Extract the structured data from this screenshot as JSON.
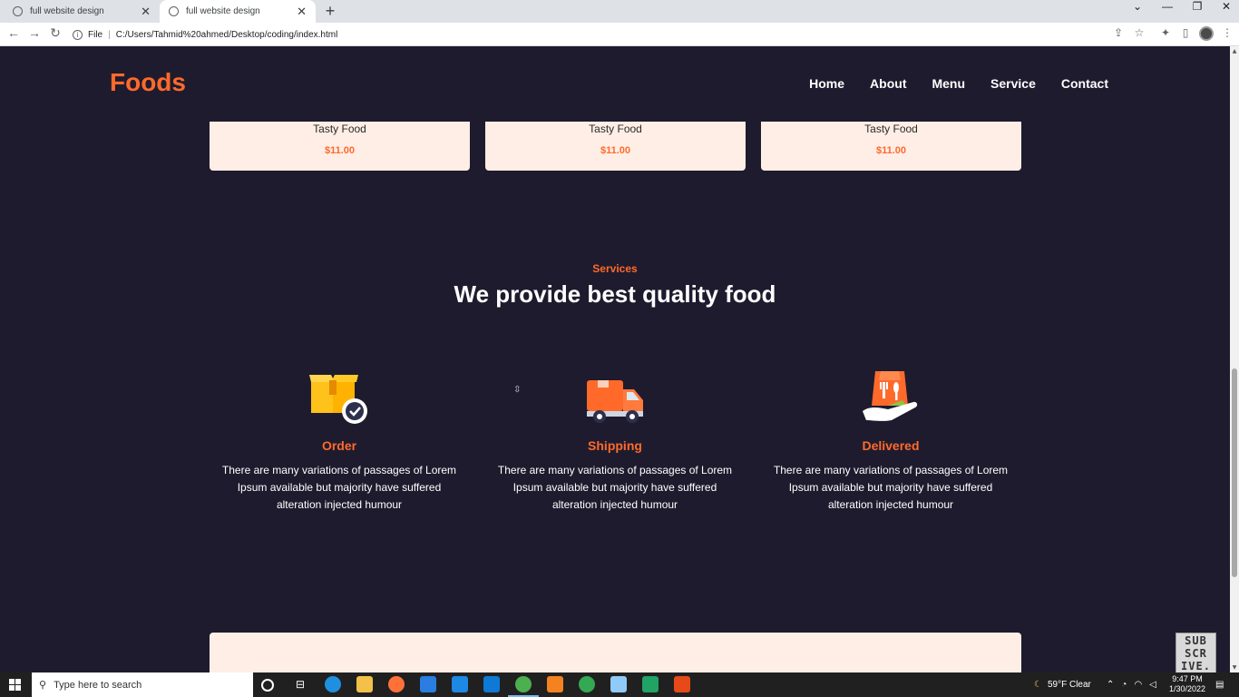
{
  "browser": {
    "tabs": [
      {
        "title": "full website design",
        "active": false
      },
      {
        "title": "full website design",
        "active": true
      }
    ],
    "new_tab": "+",
    "address": {
      "scheme_label": "File",
      "url": "C:/Users/Tahmid%20ahmed/Desktop/coding/index.html"
    }
  },
  "site": {
    "logo": "Foods",
    "nav": [
      "Home",
      "About",
      "Menu",
      "Service",
      "Contact"
    ],
    "menu_cards": [
      {
        "name": "Tasty Food",
        "price": "$11.00"
      },
      {
        "name": "Tasty Food",
        "price": "$11.00"
      },
      {
        "name": "Tasty Food",
        "price": "$11.00"
      }
    ],
    "services": {
      "eyebrow": "Services",
      "heading": "We provide best quality food",
      "items": [
        {
          "title": "Order",
          "icon": "box-check-icon",
          "description": "There are many variations of passages of Lorem Ipsum available but majority have suffered alteration injected humour"
        },
        {
          "title": "Shipping",
          "icon": "delivery-truck-icon",
          "description": "There are many variations of passages of Lorem Ipsum available but majority have suffered alteration injected humour"
        },
        {
          "title": "Delivered",
          "icon": "hand-food-bag-icon",
          "description": "There are many variations of passages of Lorem Ipsum available but majority have suffered alteration injected humour"
        }
      ]
    },
    "watermark": "SUB SCR IVE."
  },
  "taskbar": {
    "search_placeholder": "Type here to search",
    "weather": "59°F  Clear",
    "time": "9:47 PM",
    "date": "1/30/2022"
  },
  "colors": {
    "accent": "#ff6a2b",
    "background": "#1f1b2e",
    "card": "#ffeee6"
  }
}
